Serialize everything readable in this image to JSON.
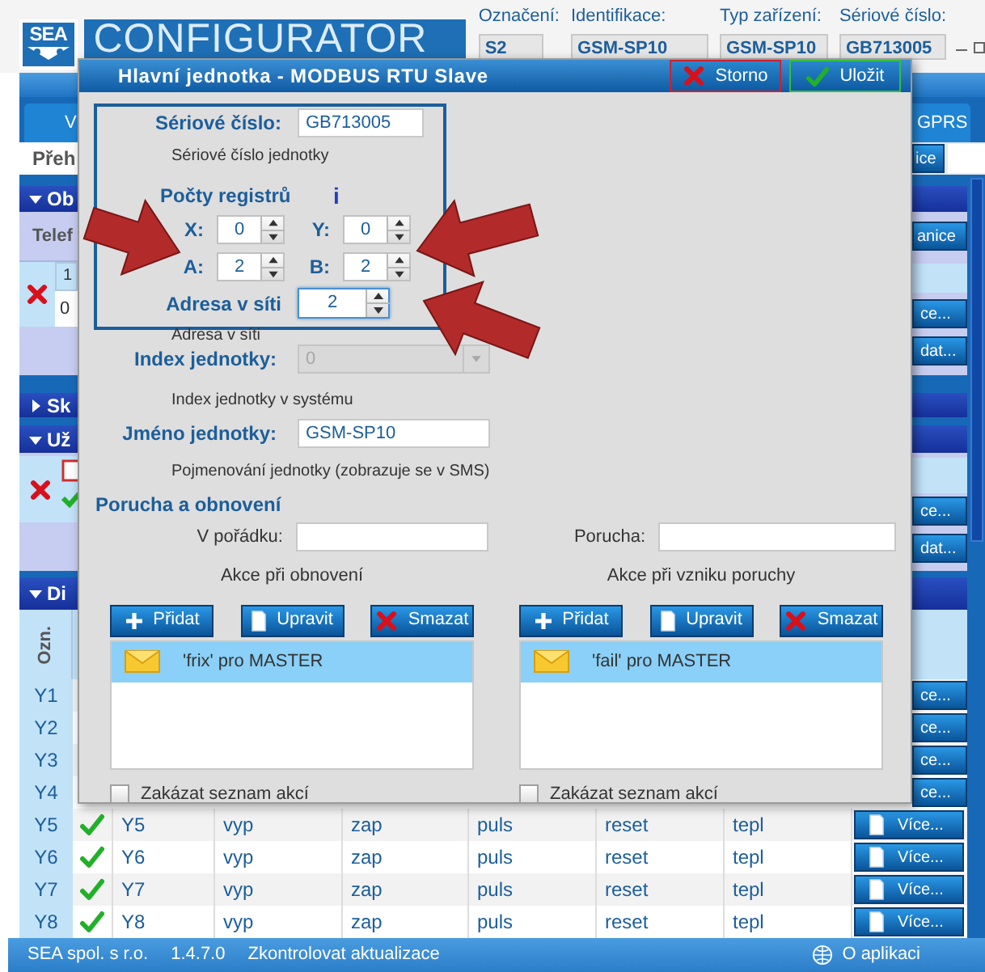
{
  "header": {
    "logo": "SEA",
    "banner": "CONFIGURATOR",
    "fields": [
      {
        "label": "Označení:",
        "value": "S2"
      },
      {
        "label": "Identifikace:",
        "value": "GSM-SP10"
      },
      {
        "label": "Typ zařízení:",
        "value": "GSM-SP10"
      },
      {
        "label": "Sériové číslo:",
        "value": "GB713005"
      }
    ]
  },
  "tabs": [
    {
      "label": "V",
      "selected": false
    },
    {
      "label": "GPRS",
      "selected": false
    }
  ],
  "view_tab": "Přeh",
  "toolbar_button": "ice",
  "sections": [
    {
      "kind": "contacts",
      "title": "Ob",
      "expanded": true,
      "column_header": "Telef",
      "header_button": "anice",
      "sub_header": "1",
      "value": "0",
      "buttons": [
        "ce...",
        "dat..."
      ]
    },
    {
      "kind": "plain",
      "title": "Sk",
      "expanded": false
    },
    {
      "kind": "users",
      "title": "Už",
      "expanded": true,
      "buttons": [
        "ce...",
        "dat..."
      ]
    },
    {
      "kind": "outputs",
      "title": "Di",
      "expanded": true,
      "column_header": "Ozn.",
      "rows": [
        {
          "ozn": "Y1",
          "button": "ce..."
        },
        {
          "ozn": "Y2",
          "button": "ce..."
        },
        {
          "ozn": "Y3",
          "button": "ce..."
        },
        {
          "ozn": "Y4",
          "button": "ce..."
        },
        {
          "ozn": "Y5",
          "enabled": true,
          "cells": [
            "Y5",
            "vyp",
            "zap",
            "puls",
            "reset",
            "tepl"
          ],
          "button": "Více..."
        },
        {
          "ozn": "Y6",
          "enabled": true,
          "cells": [
            "Y6",
            "vyp",
            "zap",
            "puls",
            "reset",
            "tepl"
          ],
          "button": "Více..."
        },
        {
          "ozn": "Y7",
          "enabled": true,
          "cells": [
            "Y7",
            "vyp",
            "zap",
            "puls",
            "reset",
            "tepl"
          ],
          "button": "Více..."
        },
        {
          "ozn": "Y8",
          "enabled": true,
          "cells": [
            "Y8",
            "vyp",
            "zap",
            "puls",
            "reset",
            "tepl"
          ],
          "button": "Více..."
        }
      ]
    }
  ],
  "status_bar": {
    "company": "SEA spol. s r.o.",
    "version": "1.4.7.0",
    "update_link": "Zkontrolovat aktualizace",
    "about": "O aplikaci"
  },
  "dialog": {
    "title": "Hlavní jednotka - MODBUS RTU Slave",
    "buttons": [
      {
        "label": "Storno",
        "kind": "cancel"
      },
      {
        "label": "Uložit",
        "kind": "save"
      }
    ],
    "serial": {
      "label": "Sériové číslo:",
      "value": "GB713005",
      "hint": "Sériové číslo jednotky"
    },
    "registers": {
      "title": "Počty registrů",
      "info": "i",
      "fields": [
        {
          "label": "X:",
          "value": "0"
        },
        {
          "label": "Y:",
          "value": "0"
        },
        {
          "label": "A:",
          "value": "2"
        },
        {
          "label": "B:",
          "value": "2"
        }
      ]
    },
    "address": {
      "label": "Adresa v síti",
      "value": "2",
      "focused": true,
      "hint": "Adresa v síti"
    },
    "index": {
      "label": "Index jednotky:",
      "value": "0",
      "disabled": true,
      "hint": "Index jednotky v systému"
    },
    "name": {
      "label": "Jméno jednotky:",
      "value": "GSM-SP10",
      "hint": "Pojmenování jednotky (zobrazuje se v SMS)"
    },
    "fault_title": "Porucha a obnovení",
    "panels": [
      {
        "field_label": "V pořádku:",
        "caption": "Akce při obnovení",
        "buttons": [
          {
            "label": "Přidat",
            "kind": "add"
          },
          {
            "label": "Upravit",
            "kind": "edit"
          },
          {
            "label": "Smazat",
            "kind": "delete"
          }
        ],
        "items": [
          {
            "label": "'frix' pro MASTER",
            "selected": true
          }
        ],
        "disable": {
          "label": "Zakázat seznam akcí",
          "checked": false
        }
      },
      {
        "field_label": "Porucha:",
        "caption": "Akce při vzniku poruchy",
        "buttons": [
          {
            "label": "Přidat",
            "kind": "add"
          },
          {
            "label": "Upravit",
            "kind": "edit"
          },
          {
            "label": "Smazat",
            "kind": "delete"
          }
        ],
        "items": [
          {
            "label": "'fail' pro MASTER",
            "selected": true
          }
        ],
        "disable": {
          "label": "Zakázat seznam akcí",
          "checked": false
        }
      }
    ]
  }
}
